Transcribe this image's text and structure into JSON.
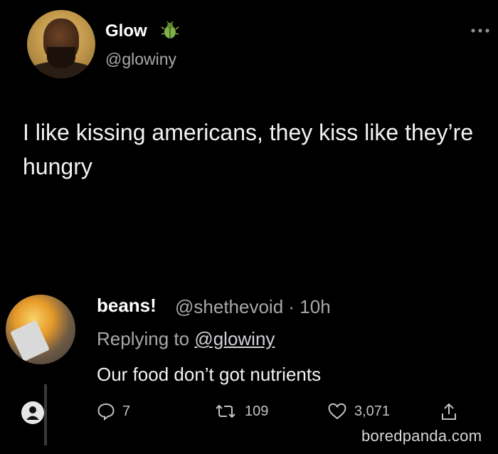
{
  "tweet": {
    "author": {
      "name": "Glow",
      "handle": "@glowiny",
      "badge_icon": "bug-icon"
    },
    "text": "I like kissing americans, they kiss like they’re hungry"
  },
  "reply": {
    "author": {
      "name": "beans!",
      "handle": "@shethevoid",
      "time": "· 10h"
    },
    "replying_to_prefix": "Replying to",
    "replying_to_mention": "@glowiny",
    "text": "Our food don’t got nutrients",
    "actions": {
      "reply_count": "7",
      "retweet_count": "109",
      "like_count": "3,071"
    }
  },
  "watermark": "boredpanda.com",
  "colors": {
    "background": "#000000",
    "text": "#ffffff",
    "secondary_text": "#a6a8ab"
  }
}
